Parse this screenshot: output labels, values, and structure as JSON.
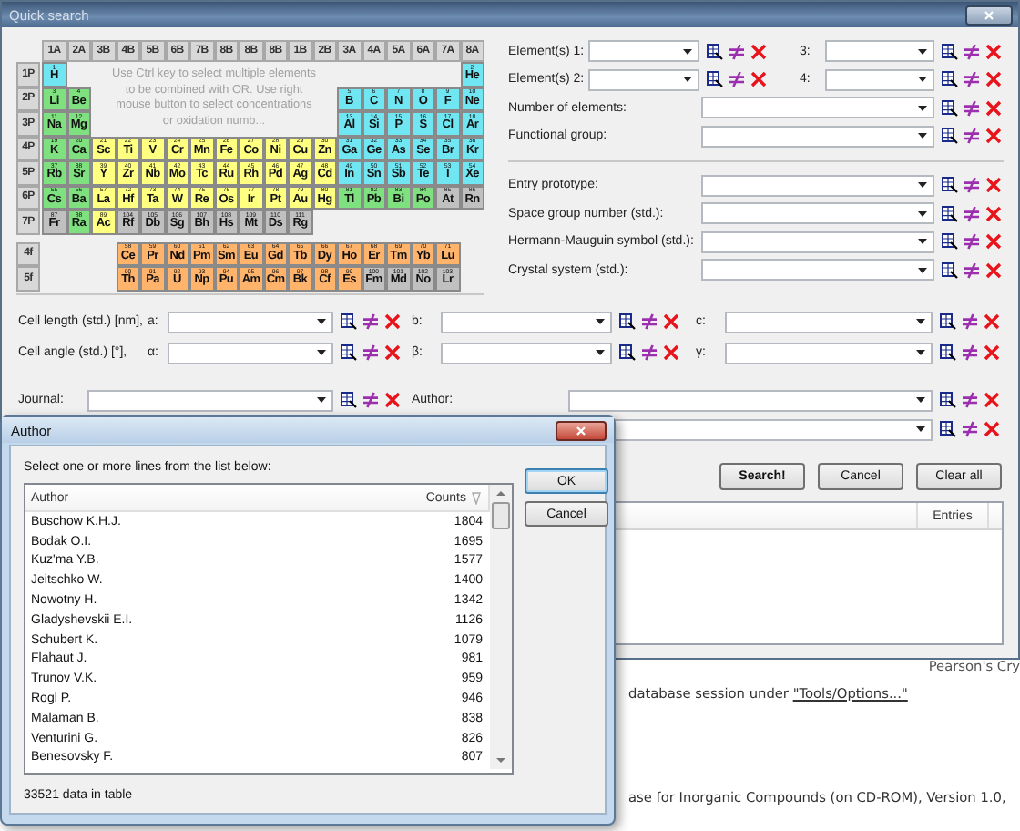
{
  "quick_search": {
    "title": "Quick search",
    "periodic_table": {
      "group_headers": [
        "1A",
        "2A",
        "3B",
        "4B",
        "5B",
        "6B",
        "7B",
        "8B",
        "8B",
        "8B",
        "1B",
        "2B",
        "3A",
        "4A",
        "5A",
        "6A",
        "7A",
        "8A"
      ],
      "hint": "Use Ctrl key to select multiple elements to be combined with OR. Use right mouse button to select concentrations or oxidation numb...",
      "rows": [
        {
          "label": "1P",
          "kind": "main",
          "left": [
            {
              "symbol": "H",
              "number": "1",
              "color": "#6fe6f2"
            }
          ],
          "right": [
            {
              "symbol": "He",
              "number": "2",
              "color": "#6fe6f2"
            }
          ]
        },
        {
          "label": "2P",
          "kind": "main",
          "left": [
            {
              "symbol": "Li",
              "number": "3",
              "color": "#7ee07e"
            },
            {
              "symbol": "Be",
              "number": "4",
              "color": "#7ee07e"
            }
          ],
          "right": [
            {
              "symbol": "B",
              "number": "5",
              "color": "#6fe6f2"
            },
            {
              "symbol": "C",
              "number": "6",
              "color": "#6fe6f2"
            },
            {
              "symbol": "N",
              "number": "7",
              "color": "#6fe6f2"
            },
            {
              "symbol": "O",
              "number": "8",
              "color": "#6fe6f2"
            },
            {
              "symbol": "F",
              "number": "9",
              "color": "#6fe6f2"
            },
            {
              "symbol": "Ne",
              "number": "10",
              "color": "#6fe6f2"
            }
          ]
        },
        {
          "label": "3P",
          "kind": "main",
          "left": [
            {
              "symbol": "Na",
              "number": "11",
              "color": "#7ee07e"
            },
            {
              "symbol": "Mg",
              "number": "12",
              "color": "#7ee07e"
            }
          ],
          "right": [
            {
              "symbol": "Al",
              "number": "13",
              "color": "#6fe6f2"
            },
            {
              "symbol": "Si",
              "number": "14",
              "color": "#6fe6f2"
            },
            {
              "symbol": "P",
              "number": "15",
              "color": "#6fe6f2"
            },
            {
              "symbol": "S",
              "number": "16",
              "color": "#6fe6f2"
            },
            {
              "symbol": "Cl",
              "number": "17",
              "color": "#6fe6f2"
            },
            {
              "symbol": "Ar",
              "number": "18",
              "color": "#6fe6f2"
            }
          ]
        },
        {
          "label": "4P",
          "kind": "main",
          "left": [
            {
              "symbol": "K",
              "number": "19",
              "color": "#7ee07e"
            },
            {
              "symbol": "Ca",
              "number": "20",
              "color": "#7ee07e"
            },
            {
              "symbol": "Sc",
              "number": "21",
              "color": "#ffff80"
            },
            {
              "symbol": "Ti",
              "number": "22",
              "color": "#ffff80"
            },
            {
              "symbol": "V",
              "number": "23",
              "color": "#ffff80"
            },
            {
              "symbol": "Cr",
              "number": "24",
              "color": "#ffff80"
            },
            {
              "symbol": "Mn",
              "number": "25",
              "color": "#ffff80"
            },
            {
              "symbol": "Fe",
              "number": "26",
              "color": "#ffff80"
            },
            {
              "symbol": "Co",
              "number": "27",
              "color": "#ffff80"
            },
            {
              "symbol": "Ni",
              "number": "28",
              "color": "#ffff80"
            },
            {
              "symbol": "Cu",
              "number": "29",
              "color": "#ffff80"
            },
            {
              "symbol": "Zn",
              "number": "30",
              "color": "#ffff80"
            },
            {
              "symbol": "Ga",
              "number": "31",
              "color": "#6fe6f2"
            },
            {
              "symbol": "Ge",
              "number": "32",
              "color": "#6fe6f2"
            },
            {
              "symbol": "As",
              "number": "33",
              "color": "#6fe6f2"
            },
            {
              "symbol": "Se",
              "number": "34",
              "color": "#6fe6f2"
            },
            {
              "symbol": "Br",
              "number": "35",
              "color": "#6fe6f2"
            },
            {
              "symbol": "Kr",
              "number": "36",
              "color": "#6fe6f2"
            }
          ]
        },
        {
          "label": "5P",
          "kind": "main",
          "left": [
            {
              "symbol": "Rb",
              "number": "37",
              "color": "#7ee07e"
            },
            {
              "symbol": "Sr",
              "number": "38",
              "color": "#7ee07e"
            },
            {
              "symbol": "Y",
              "number": "39",
              "color": "#ffff80"
            },
            {
              "symbol": "Zr",
              "number": "40",
              "color": "#ffff80"
            },
            {
              "symbol": "Nb",
              "number": "41",
              "color": "#ffff80"
            },
            {
              "symbol": "Mo",
              "number": "42",
              "color": "#ffff80"
            },
            {
              "symbol": "Tc",
              "number": "43",
              "color": "#ffff80"
            },
            {
              "symbol": "Ru",
              "number": "44",
              "color": "#ffff80"
            },
            {
              "symbol": "Rh",
              "number": "45",
              "color": "#ffff80"
            },
            {
              "symbol": "Pd",
              "number": "46",
              "color": "#ffff80"
            },
            {
              "symbol": "Ag",
              "number": "47",
              "color": "#ffff80"
            },
            {
              "symbol": "Cd",
              "number": "48",
              "color": "#ffff80"
            },
            {
              "symbol": "In",
              "number": "49",
              "color": "#6fe6f2"
            },
            {
              "symbol": "Sn",
              "number": "50",
              "color": "#6fe6f2"
            },
            {
              "symbol": "Sb",
              "number": "51",
              "color": "#6fe6f2"
            },
            {
              "symbol": "Te",
              "number": "52",
              "color": "#6fe6f2"
            },
            {
              "symbol": "I",
              "number": "53",
              "color": "#6fe6f2"
            },
            {
              "symbol": "Xe",
              "number": "54",
              "color": "#6fe6f2"
            }
          ]
        },
        {
          "label": "6P",
          "kind": "main",
          "left": [
            {
              "symbol": "Cs",
              "number": "55",
              "color": "#7ee07e"
            },
            {
              "symbol": "Ba",
              "number": "56",
              "color": "#7ee07e"
            },
            {
              "symbol": "La",
              "number": "57",
              "color": "#ffff80"
            },
            {
              "symbol": "Hf",
              "number": "72",
              "color": "#ffff80"
            },
            {
              "symbol": "Ta",
              "number": "73",
              "color": "#ffff80"
            },
            {
              "symbol": "W",
              "number": "74",
              "color": "#ffff80"
            },
            {
              "symbol": "Re",
              "number": "75",
              "color": "#ffff80"
            },
            {
              "symbol": "Os",
              "number": "76",
              "color": "#ffff80"
            },
            {
              "symbol": "Ir",
              "number": "77",
              "color": "#ffff80"
            },
            {
              "symbol": "Pt",
              "number": "78",
              "color": "#ffff80"
            },
            {
              "symbol": "Au",
              "number": "79",
              "color": "#ffff80"
            },
            {
              "symbol": "Hg",
              "number": "80",
              "color": "#ffff80"
            },
            {
              "symbol": "Tl",
              "number": "81",
              "color": "#7ee07e"
            },
            {
              "symbol": "Pb",
              "number": "82",
              "color": "#7ee07e"
            },
            {
              "symbol": "Bi",
              "number": "83",
              "color": "#7ee07e"
            },
            {
              "symbol": "Po",
              "number": "84",
              "color": "#7ee07e"
            },
            {
              "symbol": "At",
              "number": "85",
              "color": "#c0c0c0"
            },
            {
              "symbol": "Rn",
              "number": "86",
              "color": "#c0c0c0"
            }
          ]
        },
        {
          "label": "7P",
          "kind": "main",
          "left": [
            {
              "symbol": "Fr",
              "number": "87",
              "color": "#c0c0c0"
            },
            {
              "symbol": "Ra",
              "number": "88",
              "color": "#7ee07e"
            },
            {
              "symbol": "Ac",
              "number": "89",
              "color": "#ffff80"
            },
            {
              "symbol": "Rf",
              "number": "104",
              "color": "#c0c0c0"
            },
            {
              "symbol": "Db",
              "number": "105",
              "color": "#c0c0c0"
            },
            {
              "symbol": "Sg",
              "number": "106",
              "color": "#c0c0c0"
            },
            {
              "symbol": "Bh",
              "number": "107",
              "color": "#c0c0c0"
            },
            {
              "symbol": "Hs",
              "number": "108",
              "color": "#c0c0c0"
            },
            {
              "symbol": "Mt",
              "number": "109",
              "color": "#c0c0c0"
            },
            {
              "symbol": "Ds",
              "number": "110",
              "color": "#c0c0c0"
            },
            {
              "symbol": "Rg",
              "number": "111",
              "color": "#c0c0c0"
            }
          ]
        },
        {
          "label": "4f",
          "kind": "f_block",
          "left": [
            {
              "symbol": "Ce",
              "number": "58",
              "color": "#ffb36b"
            },
            {
              "symbol": "Pr",
              "number": "59",
              "color": "#ffb36b"
            },
            {
              "symbol": "Nd",
              "number": "60",
              "color": "#ffb36b"
            },
            {
              "symbol": "Pm",
              "number": "61",
              "color": "#ffb36b"
            },
            {
              "symbol": "Sm",
              "number": "62",
              "color": "#ffb36b"
            },
            {
              "symbol": "Eu",
              "number": "63",
              "color": "#ffb36b"
            },
            {
              "symbol": "Gd",
              "number": "64",
              "color": "#ffb36b"
            },
            {
              "symbol": "Tb",
              "number": "65",
              "color": "#ffb36b"
            },
            {
              "symbol": "Dy",
              "number": "66",
              "color": "#ffb36b"
            },
            {
              "symbol": "Ho",
              "number": "67",
              "color": "#ffb36b"
            },
            {
              "symbol": "Er",
              "number": "68",
              "color": "#ffb36b"
            },
            {
              "symbol": "Tm",
              "number": "69",
              "color": "#ffb36b"
            },
            {
              "symbol": "Yb",
              "number": "70",
              "color": "#ffb36b"
            },
            {
              "symbol": "Lu",
              "number": "71",
              "color": "#ffb36b"
            }
          ]
        },
        {
          "label": "5f",
          "kind": "f_block",
          "left": [
            {
              "symbol": "Th",
              "number": "90",
              "color": "#ffb36b"
            },
            {
              "symbol": "Pa",
              "number": "91",
              "color": "#ffb36b"
            },
            {
              "symbol": "U",
              "number": "92",
              "color": "#ffb36b"
            },
            {
              "symbol": "Np",
              "number": "93",
              "color": "#ffb36b"
            },
            {
              "symbol": "Pu",
              "number": "94",
              "color": "#ffb36b"
            },
            {
              "symbol": "Am",
              "number": "95",
              "color": "#ffb36b"
            },
            {
              "symbol": "Cm",
              "number": "96",
              "color": "#ffb36b"
            },
            {
              "symbol": "Bk",
              "number": "97",
              "color": "#ffb36b"
            },
            {
              "symbol": "Cf",
              "number": "98",
              "color": "#ffb36b"
            },
            {
              "symbol": "Es",
              "number": "99",
              "color": "#ffb36b"
            },
            {
              "symbol": "Fm",
              "number": "100",
              "color": "#c0c0c0"
            },
            {
              "symbol": "Md",
              "number": "101",
              "color": "#c0c0c0"
            },
            {
              "symbol": "No",
              "number": "102",
              "color": "#c0c0c0"
            },
            {
              "symbol": "Lr",
              "number": "103",
              "color": "#c0c0c0"
            }
          ]
        }
      ]
    },
    "criteria_groups": [
      {
        "fields": [
          {
            "kind": "pair",
            "label": "Element(s) 1:",
            "second_label": "3:"
          },
          {
            "kind": "pair",
            "label": "Element(s) 2:",
            "second_label": "4:"
          },
          {
            "kind": "wide",
            "label": "Number of elements:"
          },
          {
            "kind": "wide",
            "label": "Functional group:"
          }
        ]
      },
      {
        "fields": [
          {
            "kind": "wide",
            "label": "Entry prototype:"
          },
          {
            "kind": "wide",
            "label": "Space group number (std.):"
          },
          {
            "kind": "wide",
            "label": "Hermann-Mauguin symbol (std.):"
          },
          {
            "kind": "wide",
            "label": "Crystal system (std.):"
          }
        ]
      }
    ],
    "cell_rows": [
      {
        "label": "Cell length (std.) [nm],",
        "fields": [
          {
            "label": "a:"
          },
          {
            "label": "b:"
          },
          {
            "label": "c:"
          }
        ]
      },
      {
        "label": "Cell angle (std.) [°],",
        "fields": [
          {
            "label": "α:"
          },
          {
            "label": "β:"
          },
          {
            "label": "γ:"
          }
        ]
      }
    ],
    "journal_rows": [
      {
        "fields": [
          {
            "kind": "labeled",
            "label": "Journal:"
          },
          {
            "kind": "labeled",
            "label": "Author:"
          }
        ]
      },
      {
        "fields": [
          {
            "kind": "combo"
          }
        ]
      }
    ],
    "buttons": [
      {
        "label": "Search!",
        "default": true
      },
      {
        "label": "Cancel",
        "default": false
      },
      {
        "label": "Clear all",
        "default": false
      }
    ],
    "results": {
      "columns": [
        "Entries"
      ]
    }
  },
  "author_dialog": {
    "title": "Author",
    "prompt": "Select one or more lines from the list below:",
    "columns": [
      {
        "label": "Author",
        "sorted": false
      },
      {
        "label": "Counts",
        "sorted": true
      }
    ],
    "rows": [
      {
        "author": "Buschow K.H.J.",
        "count": "1804"
      },
      {
        "author": "Bodak O.I.",
        "count": "1695"
      },
      {
        "author": "Kuz'ma Y.B.",
        "count": "1577"
      },
      {
        "author": "Jeitschko W.",
        "count": "1400"
      },
      {
        "author": "Nowotny H.",
        "count": "1342"
      },
      {
        "author": "Gladyshevskii E.I.",
        "count": "1126"
      },
      {
        "author": "Schubert K.",
        "count": "1079"
      },
      {
        "author": "Flahaut J.",
        "count": "981"
      },
      {
        "author": "Trunov V.K.",
        "count": "959"
      },
      {
        "author": "Rogl P.",
        "count": "946"
      },
      {
        "author": "Malaman B.",
        "count": "838"
      },
      {
        "author": "Venturini G.",
        "count": "826"
      },
      {
        "author": "Benesovsky F.",
        "count": "807"
      }
    ],
    "buttons": [
      {
        "label": "OK",
        "default": true
      },
      {
        "label": "Cancel",
        "default": false
      }
    ],
    "status": "33521 data in table"
  },
  "background_document": {
    "lines": [
      {
        "kind": "header",
        "text": "Pearson's Cry"
      },
      {
        "kind": "paragraph",
        "text": "database session under ",
        "link": "\"Tools/Options...\""
      },
      {
        "kind": "paragraph",
        "text": "ase for Inorganic Compounds (on CD-ROM), Version 1.0,"
      }
    ]
  }
}
